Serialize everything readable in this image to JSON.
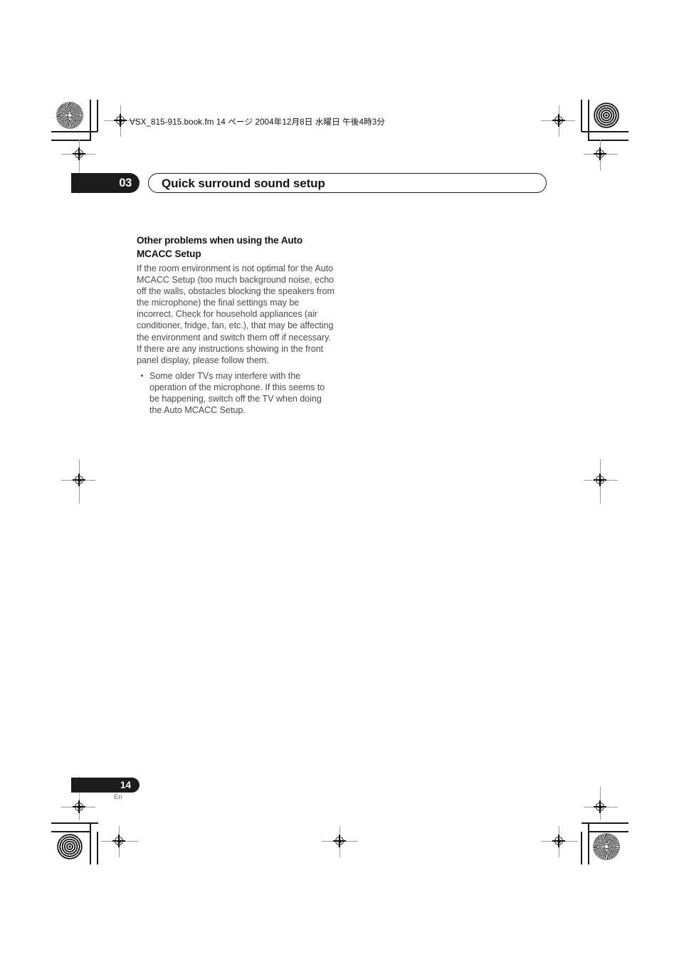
{
  "document": {
    "slug": {
      "filename": "VSX_815-915.book.fm",
      "page_label": "14 ページ",
      "date": "2004年12月8日",
      "weekday": "水曜日",
      "time": "午後4時3分",
      "full": "VSX_815-915.book.fm  14 ページ  2004年12月8日   水曜日   午後4時3分"
    },
    "chapter": {
      "number": "03",
      "title": "Quick surround sound setup"
    },
    "content": {
      "heading": "Other problems when using the Auto MCACC Setup",
      "paragraph": "If the room environment is not optimal for the Auto MCACC Setup (too much background noise, echo off the walls, obstacles blocking the speakers from the microphone) the final settings may be incorrect. Check for household appliances (air conditioner, fridge, fan, etc.), that may be affecting the environment and switch them off if necessary. If there are any instructions showing in the front panel display, please follow them.",
      "bullets": [
        "Some older TVs may interfere with the operation of the microphone. If this seems to be happening, switch off the TV when doing the Auto MCACC Setup."
      ]
    },
    "footer": {
      "page_number": "14",
      "language": "En"
    },
    "colors": {
      "ink_black": "#1b1b1b",
      "body_gray": "#4b4b4b",
      "paper": "#ffffff"
    }
  }
}
